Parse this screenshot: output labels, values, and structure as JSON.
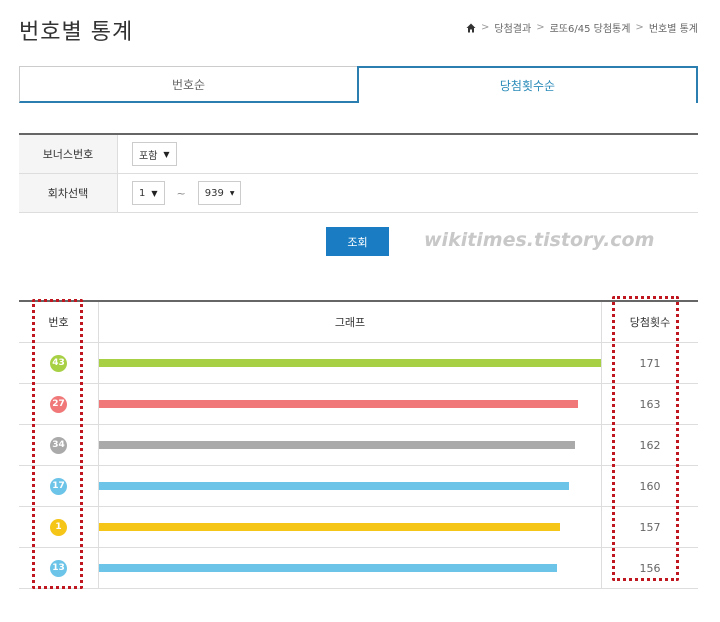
{
  "page": {
    "title": "번호별 통계"
  },
  "breadcrumb": {
    "items": [
      "당첨결과",
      "로또6/45 당첨통계",
      "번호별 통계"
    ]
  },
  "tabs": [
    {
      "label": "번호순",
      "active": false
    },
    {
      "label": "당첨횟수순",
      "active": true
    }
  ],
  "filters": {
    "bonus": {
      "label": "보너스번호",
      "value": "포함"
    },
    "round": {
      "label": "회차선택",
      "from": "1",
      "tilde": "~",
      "to": "939"
    }
  },
  "search": {
    "label": "조회"
  },
  "watermark": "wikitimes.tistory.com",
  "results": {
    "headers": {
      "number": "번호",
      "graph": "그래프",
      "count": "당첨횟수"
    },
    "max_value": 171,
    "rows": [
      {
        "number": "43",
        "count": "171",
        "value": 171,
        "color": "#a8d045"
      },
      {
        "number": "27",
        "count": "163",
        "value": 163,
        "color": "#f07878"
      },
      {
        "number": "34",
        "count": "162",
        "value": 162,
        "color": "#aaaaaa"
      },
      {
        "number": "17",
        "count": "160",
        "value": 160,
        "color": "#6cc4e8"
      },
      {
        "number": "1",
        "count": "157",
        "value": 157,
        "color": "#f5c518"
      },
      {
        "number": "13",
        "count": "156",
        "value": 156,
        "color": "#6cc4e8"
      }
    ]
  },
  "colors": {
    "accent": "#1a7dc4",
    "highlight": "#c0161f"
  }
}
